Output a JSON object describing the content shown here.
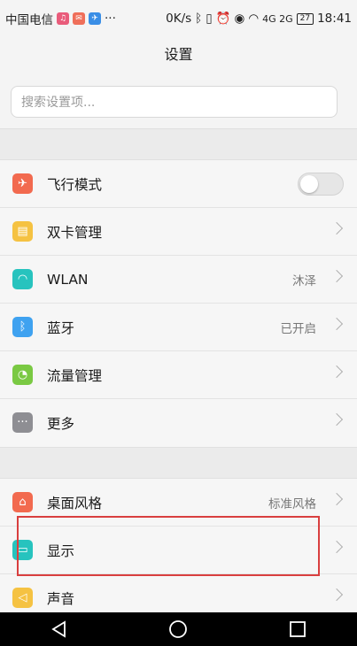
{
  "status_bar": {
    "carrier": "中国电信",
    "net_speed": "0K/s",
    "signal": "4G 2G",
    "battery": "27",
    "time": "18:41",
    "more": "···"
  },
  "header": {
    "title": "设置"
  },
  "search": {
    "placeholder": "搜索设置项..."
  },
  "groups": [
    {
      "items": [
        {
          "label": "飞行模式",
          "value": "",
          "icon": "airplane-icon",
          "color": "#f26a4f",
          "control": "toggle"
        },
        {
          "label": "双卡管理",
          "value": "",
          "icon": "sim-card-icon",
          "color": "#f5c242",
          "control": "chevron"
        },
        {
          "label": "WLAN",
          "value": "沐泽",
          "icon": "wifi-icon",
          "color": "#27c3be",
          "control": "chevron"
        },
        {
          "label": "蓝牙",
          "value": "已开启",
          "icon": "bluetooth-icon",
          "color": "#3fa2f0",
          "control": "chevron"
        },
        {
          "label": "流量管理",
          "value": "",
          "icon": "data-usage-icon",
          "color": "#7ac943",
          "control": "chevron"
        },
        {
          "label": "更多",
          "value": "",
          "icon": "more-icon",
          "color": "#8e8e93",
          "control": "chevron"
        }
      ]
    },
    {
      "items": [
        {
          "label": "桌面风格",
          "value": "标准风格",
          "icon": "home-icon",
          "color": "#f26a4f",
          "control": "chevron"
        },
        {
          "label": "显示",
          "value": "",
          "icon": "display-icon",
          "color": "#27c3be",
          "control": "chevron"
        },
        {
          "label": "声音",
          "value": "",
          "icon": "sound-icon",
          "color": "#f5c242",
          "control": "chevron"
        }
      ]
    }
  ],
  "nav": {
    "back": "back-icon",
    "home": "home-circle-icon",
    "recent": "recent-apps-icon"
  }
}
